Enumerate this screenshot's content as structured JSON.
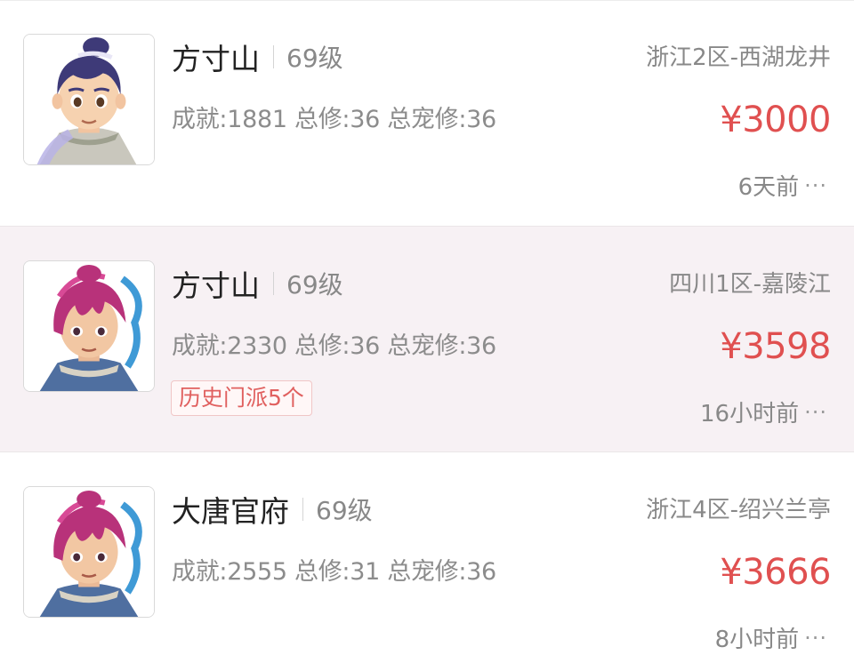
{
  "listings": [
    {
      "school": "方寸山",
      "level": "69级",
      "server": "浙江2区-西湖龙井",
      "stats": "成就:1881 总修:36 总宠修:36",
      "price": "¥3000",
      "time": "6天前",
      "tag": "",
      "more": "···",
      "highlight": false
    },
    {
      "school": "方寸山",
      "level": "69级",
      "server": "四川1区-嘉陵江",
      "stats": "成就:2330 总修:36 总宠修:36",
      "price": "¥3598",
      "time": "16小时前",
      "tag": "历史门派5个",
      "more": "···",
      "highlight": true
    },
    {
      "school": "大唐官府",
      "level": "69级",
      "server": "浙江4区-绍兴兰亭",
      "stats": "成就:2555 总修:31 总宠修:36",
      "price": "¥3666",
      "time": "8小时前",
      "tag": "",
      "more": "···",
      "highlight": false
    }
  ],
  "colors": {
    "price": "#e05050",
    "tag_text": "#e0605f",
    "highlight_bg": "#f7f1f4"
  }
}
